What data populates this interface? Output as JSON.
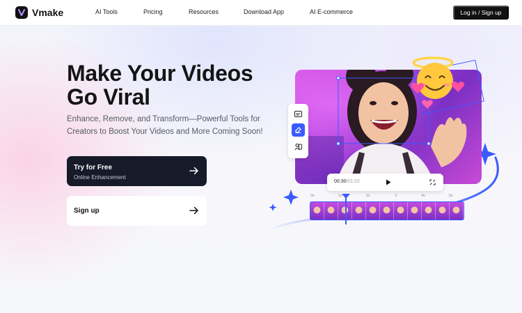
{
  "brand": {
    "name": "Vmake"
  },
  "nav": {
    "items": [
      {
        "label": "AI Tools"
      },
      {
        "label": "Pricing"
      },
      {
        "label": "Resources"
      },
      {
        "label": "Download App"
      },
      {
        "label": "AI E-commerce"
      }
    ],
    "login_label": "Log in / Sign up"
  },
  "hero": {
    "title_line1": "Make Your Videos",
    "title_line2": "Go Viral",
    "subtitle": "Enhance, Remove, and Transform—Powerful Tools for Creators to Boost Your Videos and More Coming Soon!",
    "primary_cta": {
      "label": "Try for Free",
      "sublabel": "Online Enhancement"
    },
    "secondary_cta": {
      "label": "Sign up"
    }
  },
  "player": {
    "current_time": "00:30",
    "duration": "/01:02"
  },
  "timeline": {
    "ticks": [
      "0s",
      "1s",
      "2s",
      "3",
      "4s",
      "5s"
    ]
  },
  "tools": [
    "subtitle-icon",
    "eraser-icon",
    "person-swap-icon"
  ],
  "colors": {
    "accent": "#3b5bff",
    "dark_button": "#161a29",
    "photo_bg": "#a53bd8"
  }
}
